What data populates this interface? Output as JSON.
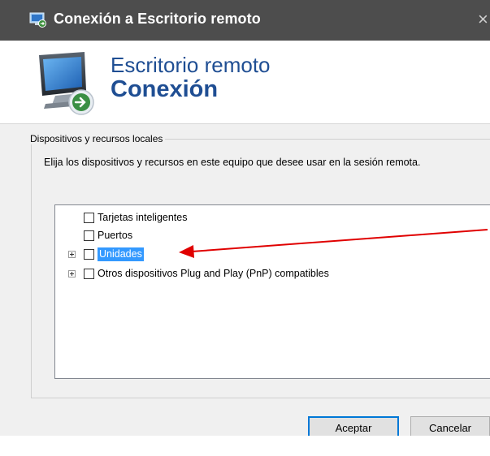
{
  "window": {
    "title": "Conexión a Escritorio remoto",
    "close_glyph": "×",
    "icon": "remote-desktop-icon"
  },
  "header": {
    "line1": "Escritorio remoto",
    "line2": "Conexión",
    "icon": "remote-desktop-monitor-icon"
  },
  "group": {
    "label": "Dispositivos y recursos locales",
    "description": "Elija los dispositivos y recursos en este equipo que desee usar en la sesión remota."
  },
  "devices": [
    {
      "label": "Tarjetas inteligentes",
      "checked": false,
      "expandable": false,
      "selected": false
    },
    {
      "label": "Puertos",
      "checked": false,
      "expandable": false,
      "selected": false
    },
    {
      "label": "Unidades",
      "checked": false,
      "expandable": true,
      "selected": true
    },
    {
      "label": "Otros dispositivos Plug and Play (PnP) compatibles",
      "checked": false,
      "expandable": true,
      "selected": false
    }
  ],
  "buttons": {
    "ok": "Aceptar",
    "cancel": "Cancelar"
  },
  "colors": {
    "annotation_arrow": "#e00000",
    "selection": "#3399ff",
    "title_bar": "#4d4d4d",
    "header_text": "#1f4e93"
  }
}
